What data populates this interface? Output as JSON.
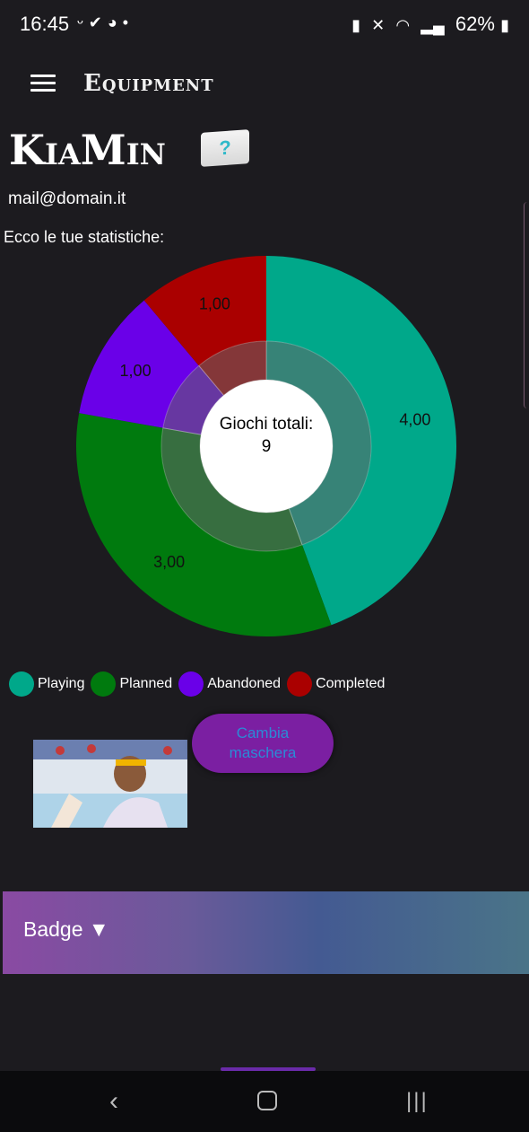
{
  "status_bar": {
    "time": "16:45",
    "left_icons": [
      "notification-icon",
      "check-icon",
      "reddit-icon"
    ],
    "dot": "•",
    "battery": "62%"
  },
  "app_bar": {
    "title": "Equipment"
  },
  "profile": {
    "name": "KiaMin",
    "flag_glyph": "?",
    "email": "mail@domain.it",
    "stats_intro": "Ecco le tue statistiche:"
  },
  "chart_data": {
    "type": "pie",
    "style": "donut",
    "categories": [
      "Playing",
      "Planned",
      "Abandoned",
      "Completed"
    ],
    "values": [
      4,
      3,
      1,
      1
    ],
    "value_labels": [
      "4,00",
      "3,00",
      "1,00",
      "1,00"
    ],
    "colors": [
      "#00a88a",
      "#007a0e",
      "#6a00e8",
      "#aa0000"
    ],
    "center_label": "Giochi totali:",
    "center_value": "9",
    "legend_position": "bottom"
  },
  "actions": {
    "change_mask": "Cambia\nmaschera"
  },
  "badge": {
    "label": "Badge ▼"
  }
}
